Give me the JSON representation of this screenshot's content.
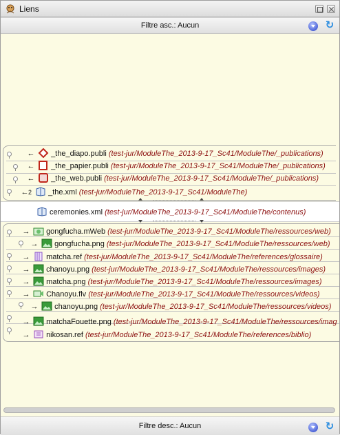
{
  "window": {
    "title": "Liens"
  },
  "filter_top": {
    "label": "Filtre asc.: Aucun"
  },
  "filter_bottom": {
    "label": "Filtre desc.: Aucun"
  },
  "ascendants": [
    {
      "name": "_the_diapo.publi",
      "path": "(test-jur/ModuleThe_2013-9-17_Sc41/ModuleThe/_publications)",
      "arrow": "←",
      "count": ""
    },
    {
      "name": "_the_papier.publi",
      "path": "(test-jur/ModuleThe_2013-9-17_Sc41/ModuleThe/_publications)",
      "arrow": "←",
      "count": ""
    },
    {
      "name": "_the_web.publi",
      "path": "(test-jur/ModuleThe_2013-9-17_Sc41/ModuleThe/_publications)",
      "arrow": "←",
      "count": ""
    },
    {
      "name": "_the.xml",
      "path": "(test-jur/ModuleThe_2013-9-17_Sc41/ModuleThe)",
      "arrow": "←",
      "count": "2"
    }
  ],
  "current": {
    "name": "ceremonies.xml",
    "path": "(test-jur/ModuleThe_2013-9-17_Sc41/ModuleThe/contenus)"
  },
  "descendants": [
    {
      "name": "gongfucha.mWeb",
      "path": "(test-jur/ModuleThe_2013-9-17_Sc41/ModuleThe/ressources/web)"
    },
    {
      "name": "gongfucha.png",
      "path": "(test-jur/ModuleThe_2013-9-17_Sc41/ModuleThe/ressources/web)"
    },
    {
      "name": "matcha.ref",
      "path": "(test-jur/ModuleThe_2013-9-17_Sc41/ModuleThe/references/glossaire)"
    },
    {
      "name": "chanoyu.png",
      "path": "(test-jur/ModuleThe_2013-9-17_Sc41/ModuleThe/ressources/images)"
    },
    {
      "name": "matcha.png",
      "path": "(test-jur/ModuleThe_2013-9-17_Sc41/ModuleThe/ressources/images)"
    },
    {
      "name": "Chanoyu.flv",
      "path": "(test-jur/ModuleThe_2013-9-17_Sc41/ModuleThe/ressources/videos)"
    },
    {
      "name": "chanoyu.png",
      "path": "(test-jur/ModuleThe_2013-9-17_Sc41/ModuleThe/ressources/videos)"
    },
    {
      "name": "matchaFouette.png",
      "path": "(test-jur/ModuleThe_2013-9-17_Sc41/ModuleThe/ressources/imag"
    },
    {
      "name": "nikosan.ref",
      "path": "(test-jur/ModuleThe_2013-9-17_Sc41/ModuleThe/references/biblio)"
    }
  ],
  "colors": {
    "background": "#fcfbe3",
    "path_text": "#8c1010"
  }
}
